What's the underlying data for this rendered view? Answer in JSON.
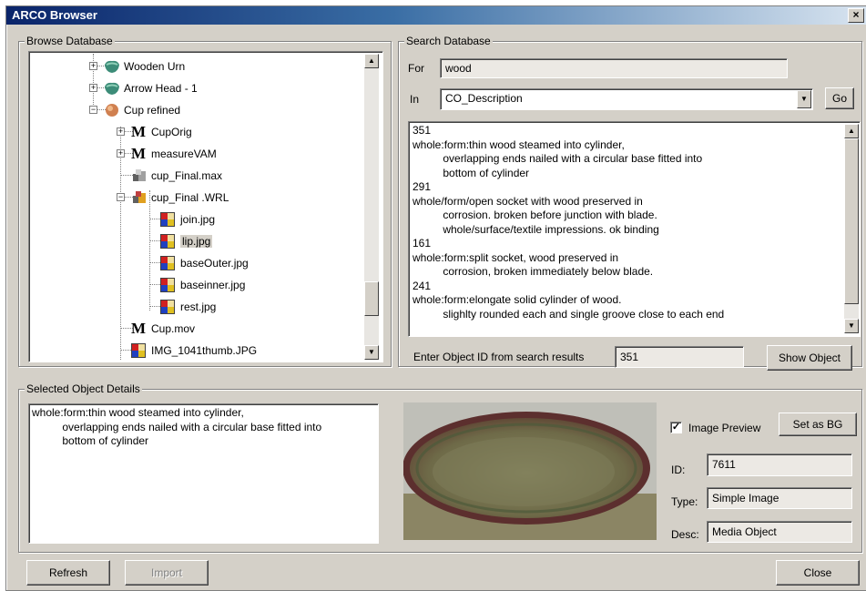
{
  "window": {
    "title": "ARCO Browser",
    "close_glyph": "×"
  },
  "browse": {
    "group_label": "Browse Database",
    "tree": [
      {
        "label": "Wooden Urn",
        "icon": "green-object-icon",
        "expander": "+",
        "level": 0
      },
      {
        "label": "Arrow Head - 1",
        "icon": "green-object-icon",
        "expander": "+",
        "level": 0
      },
      {
        "label": "Cup refined",
        "icon": "orange-object-icon",
        "expander": "−",
        "level": 0
      },
      {
        "label": "CupOrig",
        "icon": "m-icon",
        "expander": "+",
        "level": 1
      },
      {
        "label": "measureVAM",
        "icon": "m-icon",
        "expander": "+",
        "level": 1
      },
      {
        "label": "cup_Final.max",
        "icon": "max-file-icon",
        "expander": "",
        "level": 1
      },
      {
        "label": "cup_Final .WRL",
        "icon": "wrl-file-icon",
        "expander": "−",
        "level": 1
      },
      {
        "label": "join.jpg",
        "icon": "jpg-file-icon",
        "expander": "",
        "level": 2
      },
      {
        "label": "lip.jpg",
        "icon": "jpg-file-icon",
        "expander": "",
        "level": 2,
        "selected": true
      },
      {
        "label": "baseOuter.jpg",
        "icon": "jpg-file-icon",
        "expander": "",
        "level": 2
      },
      {
        "label": "baseinner.jpg",
        "icon": "jpg-file-icon",
        "expander": "",
        "level": 2
      },
      {
        "label": "rest.jpg",
        "icon": "jpg-file-icon",
        "expander": "",
        "level": 2
      },
      {
        "label": "Cup.mov",
        "icon": "m-icon",
        "expander": "",
        "level": 1
      },
      {
        "label": "IMG_1041thumb.JPG",
        "icon": "jpg-file-icon",
        "expander": "",
        "level": 1
      }
    ]
  },
  "search": {
    "group_label": "Search Database",
    "for_label": "For",
    "for_value": "wood",
    "in_label": "In",
    "in_value": "CO_Description",
    "go_label": "Go",
    "results": [
      {
        "id": "351",
        "lines": [
          "whole:form:thin wood steamed into cylinder,",
          "          overlapping ends nailed with a circular base fitted into",
          "          bottom of cylinder"
        ]
      },
      {
        "id": "291",
        "lines": [
          "whole/form/open socket with wood preserved in",
          "          corrosion. broken before junction with blade.",
          "          whole/surface/textile impressions. ok binding"
        ]
      },
      {
        "id": "161",
        "lines": [
          "whole:form:split socket, wood preserved in",
          "          corrosion, broken immediately below blade."
        ]
      },
      {
        "id": "241",
        "lines": [
          "whole:form:elongate solid cylinder of wood.",
          "          slighlty rounded each and single groove close to each end"
        ]
      }
    ],
    "object_id_label": "Enter Object ID from search results",
    "object_id_value": "351",
    "show_object_label": "Show Object"
  },
  "details": {
    "group_label": "Selected Object Details",
    "text": "whole:form:thin wood steamed into cylinder,\n          overlapping ends nailed with a circular base fitted into\n          bottom of cylinder",
    "image_preview_label": "Image Preview",
    "image_preview_checked": "✓",
    "set_bg_label": "Set as BG",
    "id_label": "ID:",
    "id_value": "7611",
    "type_label": "Type:",
    "type_value": "Simple Image",
    "desc_label": "Desc:",
    "desc_value": "Media Object"
  },
  "footer": {
    "refresh_label": "Refresh",
    "import_label": "Import",
    "close_label": "Close"
  }
}
